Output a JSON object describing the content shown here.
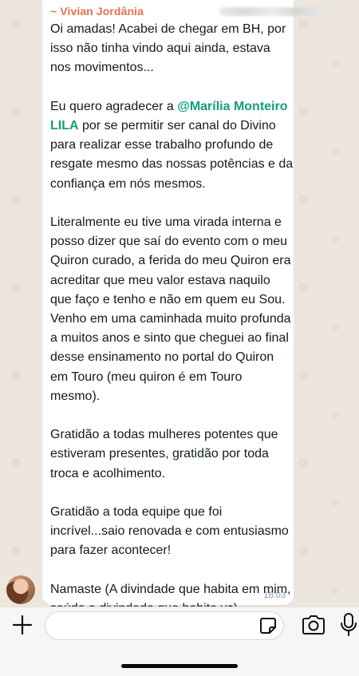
{
  "message": {
    "sender": "~ Vivian Jordânia",
    "paragraphs": [
      "Oi amadas! Acabei de chegar em BH, por isso não tinha vindo aqui ainda, estava nos movimentos...",
      "Literalmente eu tive uma virada interna e posso dizer que saí do evento com o meu Quiron curado, a ferida do meu Quiron era acreditar que meu valor estava naquilo que faço e tenho e não em quem eu Sou. Venho em uma caminhada muito profunda a muitos anos e sinto que cheguei ao final desse ensinamento no portal do Quiron em Touro (meu quiron é em Touro mesmo).",
      "Gratidão a todas mulheres potentes que estiveram presentes, gratidão por toda troca e acolhimento.",
      "Gratidão a toda equipe que foi incrível...saio renovada e com entusiasmo para fazer acontecer!",
      "Namaste (A divindade que habita em mim, saúda a divindade que habita vc)"
    ],
    "thanks_before": "Eu quero agradecer a ",
    "mention": "@Marília Monteiro LILA",
    "thanks_after": " por se permitir ser canal do Divino para realizar esse trabalho profundo de resgate mesmo das nossas potências e da confiança em nós mesmos.",
    "emojis": "🙏🏻🌹😘🔥",
    "time": "18:03"
  },
  "composer": {
    "input_value": "",
    "input_placeholder": ""
  },
  "icons": {
    "plus": "plus-icon",
    "sticker": "sticker-icon",
    "camera": "camera-icon",
    "mic": "microphone-icon"
  },
  "colors": {
    "sender": "#e5714c",
    "mention": "#139e7a"
  }
}
